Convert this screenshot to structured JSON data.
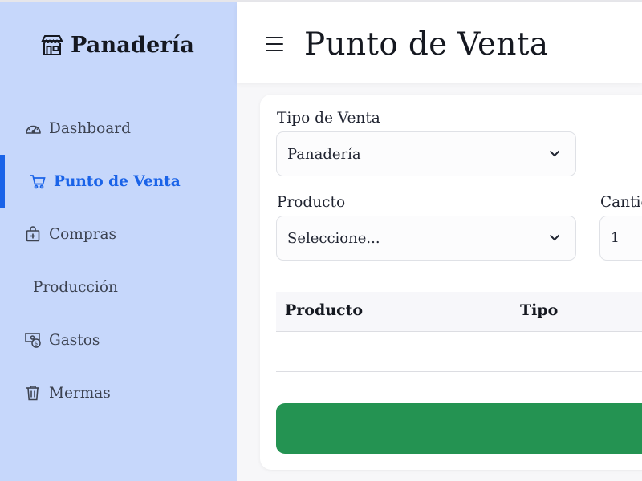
{
  "app": {
    "brand": "Panadería",
    "brand_icon": "store-icon"
  },
  "sidebar": {
    "active_color": "#1a63e8",
    "items": [
      {
        "label": "Dashboard",
        "icon": "speedometer-icon"
      },
      {
        "label": "Punto de Venta",
        "icon": "cart-icon",
        "active": true
      },
      {
        "label": "Compras",
        "icon": "bag-plus-icon"
      },
      {
        "label": "Producción",
        "icon": ""
      },
      {
        "label": "Gastos",
        "icon": "cash-coin-icon"
      },
      {
        "label": "Mermas",
        "icon": "trash-icon"
      }
    ]
  },
  "header": {
    "title": "Punto de Venta",
    "menu_icon": "hamburger-icon"
  },
  "form": {
    "sale_type": {
      "label": "Tipo de Venta",
      "value": "Panadería"
    },
    "product": {
      "label": "Producto",
      "value": "Seleccione..."
    },
    "quantity": {
      "label": "Cantic",
      "value": "1"
    }
  },
  "table": {
    "columns": [
      "Producto",
      "Tipo"
    ],
    "rows": []
  },
  "submit_button": {
    "label": "",
    "color": "#249352"
  }
}
